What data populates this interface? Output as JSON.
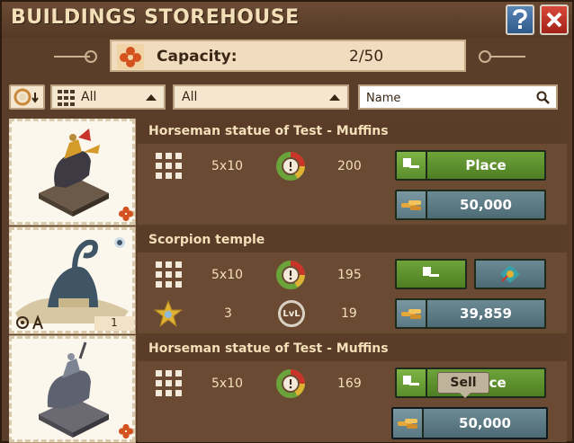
{
  "window": {
    "title": "BUILDINGS STOREHOUSE",
    "help_icon": "question-icon",
    "close_icon": "close-icon"
  },
  "capacity": {
    "label": "Capacity:",
    "value": "2/50",
    "icon": "clover-icon"
  },
  "filters": {
    "sort_icon": "sort-clock-icon",
    "size_filter": {
      "icon": "grid-icon",
      "selected": "All"
    },
    "type_filter": {
      "selected": "All"
    },
    "search": {
      "placeholder": "Name",
      "value": ""
    }
  },
  "items": [
    {
      "name": "Horseman statue of Test - Muffins",
      "size": "5x10",
      "happiness": "200",
      "place_label": "Place",
      "sell_price": "50,000",
      "count": ""
    },
    {
      "name": "Scorpion temple",
      "size": "5x10",
      "happiness": "195",
      "level": "3",
      "level_label": "LvL",
      "level_value": "19",
      "sell_price": "39,859",
      "count": "1"
    },
    {
      "name": "Horseman statue of Test - Muffins",
      "size": "5x10",
      "happiness": "169",
      "place_label": "Place",
      "sell_price": "50,000",
      "count": ""
    }
  ],
  "tooltip": {
    "text": "Sell"
  },
  "colors": {
    "title": "#f3dfb8",
    "panel": "#5b3e2a",
    "green_button": "#5e922e",
    "slate_button": "#5c7a84"
  }
}
